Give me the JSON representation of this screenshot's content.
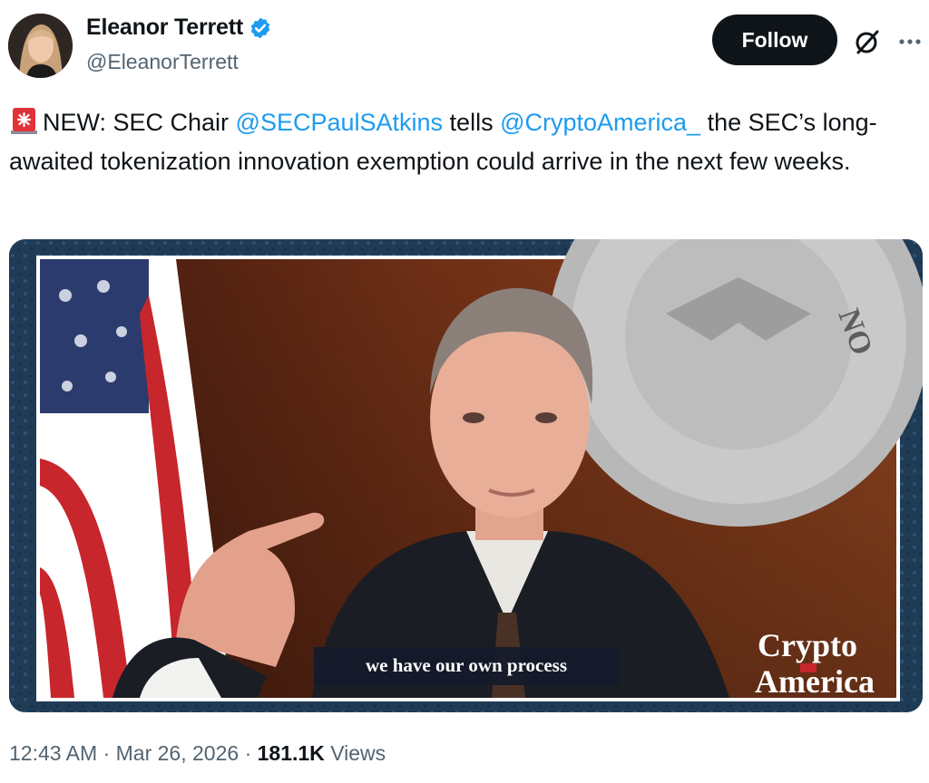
{
  "author": {
    "display_name": "Eleanor Terrett",
    "handle": "@EleanorTerrett",
    "verified": true,
    "verified_color": "#1d9bf0"
  },
  "actions": {
    "follow_label": "Follow",
    "grok_icon": "slashed-circle-icon",
    "more_icon": "more-dots-icon"
  },
  "tweet": {
    "emoji": "rotating-light-icon",
    "text_1": "NEW: SEC Chair ",
    "mention_1": "@SECPaulSAtkins",
    "text_2": " tells ",
    "mention_2": "@CryptoAmerica_",
    "text_3": " the SEC’s long-awaited tokenization innovation exemption could arrive in the next few weeks.",
    "mention_color": "#1d9bf0"
  },
  "media": {
    "caption": "we have our own process",
    "watermark_line_1": "Crypto",
    "watermark_line_2": "America"
  },
  "meta": {
    "time": "12:43 AM",
    "date": "Mar 26, 2026",
    "views_count": "181.1K",
    "views_label": "Views"
  }
}
